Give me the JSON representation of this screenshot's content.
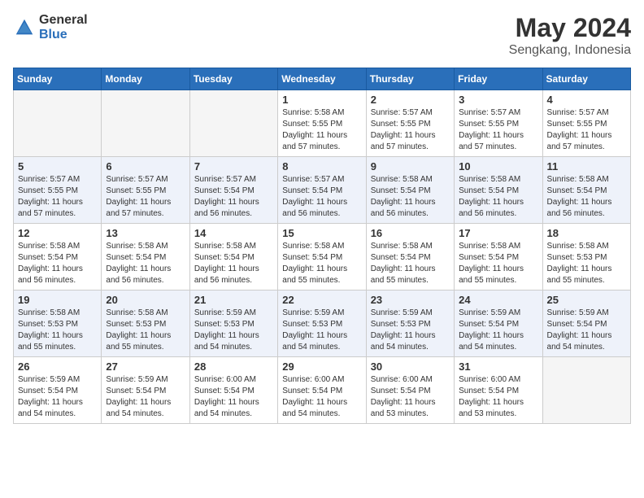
{
  "logo": {
    "general": "General",
    "blue": "Blue"
  },
  "header": {
    "title": "May 2024",
    "subtitle": "Sengkang, Indonesia"
  },
  "days_of_week": [
    "Sunday",
    "Monday",
    "Tuesday",
    "Wednesday",
    "Thursday",
    "Friday",
    "Saturday"
  ],
  "weeks": [
    [
      {
        "day": "",
        "info": ""
      },
      {
        "day": "",
        "info": ""
      },
      {
        "day": "",
        "info": ""
      },
      {
        "day": "1",
        "info": "Sunrise: 5:58 AM\nSunset: 5:55 PM\nDaylight: 11 hours\nand 57 minutes."
      },
      {
        "day": "2",
        "info": "Sunrise: 5:57 AM\nSunset: 5:55 PM\nDaylight: 11 hours\nand 57 minutes."
      },
      {
        "day": "3",
        "info": "Sunrise: 5:57 AM\nSunset: 5:55 PM\nDaylight: 11 hours\nand 57 minutes."
      },
      {
        "day": "4",
        "info": "Sunrise: 5:57 AM\nSunset: 5:55 PM\nDaylight: 11 hours\nand 57 minutes."
      }
    ],
    [
      {
        "day": "5",
        "info": "Sunrise: 5:57 AM\nSunset: 5:55 PM\nDaylight: 11 hours\nand 57 minutes."
      },
      {
        "day": "6",
        "info": "Sunrise: 5:57 AM\nSunset: 5:55 PM\nDaylight: 11 hours\nand 57 minutes."
      },
      {
        "day": "7",
        "info": "Sunrise: 5:57 AM\nSunset: 5:54 PM\nDaylight: 11 hours\nand 56 minutes."
      },
      {
        "day": "8",
        "info": "Sunrise: 5:57 AM\nSunset: 5:54 PM\nDaylight: 11 hours\nand 56 minutes."
      },
      {
        "day": "9",
        "info": "Sunrise: 5:58 AM\nSunset: 5:54 PM\nDaylight: 11 hours\nand 56 minutes."
      },
      {
        "day": "10",
        "info": "Sunrise: 5:58 AM\nSunset: 5:54 PM\nDaylight: 11 hours\nand 56 minutes."
      },
      {
        "day": "11",
        "info": "Sunrise: 5:58 AM\nSunset: 5:54 PM\nDaylight: 11 hours\nand 56 minutes."
      }
    ],
    [
      {
        "day": "12",
        "info": "Sunrise: 5:58 AM\nSunset: 5:54 PM\nDaylight: 11 hours\nand 56 minutes."
      },
      {
        "day": "13",
        "info": "Sunrise: 5:58 AM\nSunset: 5:54 PM\nDaylight: 11 hours\nand 56 minutes."
      },
      {
        "day": "14",
        "info": "Sunrise: 5:58 AM\nSunset: 5:54 PM\nDaylight: 11 hours\nand 56 minutes."
      },
      {
        "day": "15",
        "info": "Sunrise: 5:58 AM\nSunset: 5:54 PM\nDaylight: 11 hours\nand 55 minutes."
      },
      {
        "day": "16",
        "info": "Sunrise: 5:58 AM\nSunset: 5:54 PM\nDaylight: 11 hours\nand 55 minutes."
      },
      {
        "day": "17",
        "info": "Sunrise: 5:58 AM\nSunset: 5:54 PM\nDaylight: 11 hours\nand 55 minutes."
      },
      {
        "day": "18",
        "info": "Sunrise: 5:58 AM\nSunset: 5:53 PM\nDaylight: 11 hours\nand 55 minutes."
      }
    ],
    [
      {
        "day": "19",
        "info": "Sunrise: 5:58 AM\nSunset: 5:53 PM\nDaylight: 11 hours\nand 55 minutes."
      },
      {
        "day": "20",
        "info": "Sunrise: 5:58 AM\nSunset: 5:53 PM\nDaylight: 11 hours\nand 55 minutes."
      },
      {
        "day": "21",
        "info": "Sunrise: 5:59 AM\nSunset: 5:53 PM\nDaylight: 11 hours\nand 54 minutes."
      },
      {
        "day": "22",
        "info": "Sunrise: 5:59 AM\nSunset: 5:53 PM\nDaylight: 11 hours\nand 54 minutes."
      },
      {
        "day": "23",
        "info": "Sunrise: 5:59 AM\nSunset: 5:53 PM\nDaylight: 11 hours\nand 54 minutes."
      },
      {
        "day": "24",
        "info": "Sunrise: 5:59 AM\nSunset: 5:54 PM\nDaylight: 11 hours\nand 54 minutes."
      },
      {
        "day": "25",
        "info": "Sunrise: 5:59 AM\nSunset: 5:54 PM\nDaylight: 11 hours\nand 54 minutes."
      }
    ],
    [
      {
        "day": "26",
        "info": "Sunrise: 5:59 AM\nSunset: 5:54 PM\nDaylight: 11 hours\nand 54 minutes."
      },
      {
        "day": "27",
        "info": "Sunrise: 5:59 AM\nSunset: 5:54 PM\nDaylight: 11 hours\nand 54 minutes."
      },
      {
        "day": "28",
        "info": "Sunrise: 6:00 AM\nSunset: 5:54 PM\nDaylight: 11 hours\nand 54 minutes."
      },
      {
        "day": "29",
        "info": "Sunrise: 6:00 AM\nSunset: 5:54 PM\nDaylight: 11 hours\nand 54 minutes."
      },
      {
        "day": "30",
        "info": "Sunrise: 6:00 AM\nSunset: 5:54 PM\nDaylight: 11 hours\nand 53 minutes."
      },
      {
        "day": "31",
        "info": "Sunrise: 6:00 AM\nSunset: 5:54 PM\nDaylight: 11 hours\nand 53 minutes."
      },
      {
        "day": "",
        "info": ""
      }
    ]
  ]
}
